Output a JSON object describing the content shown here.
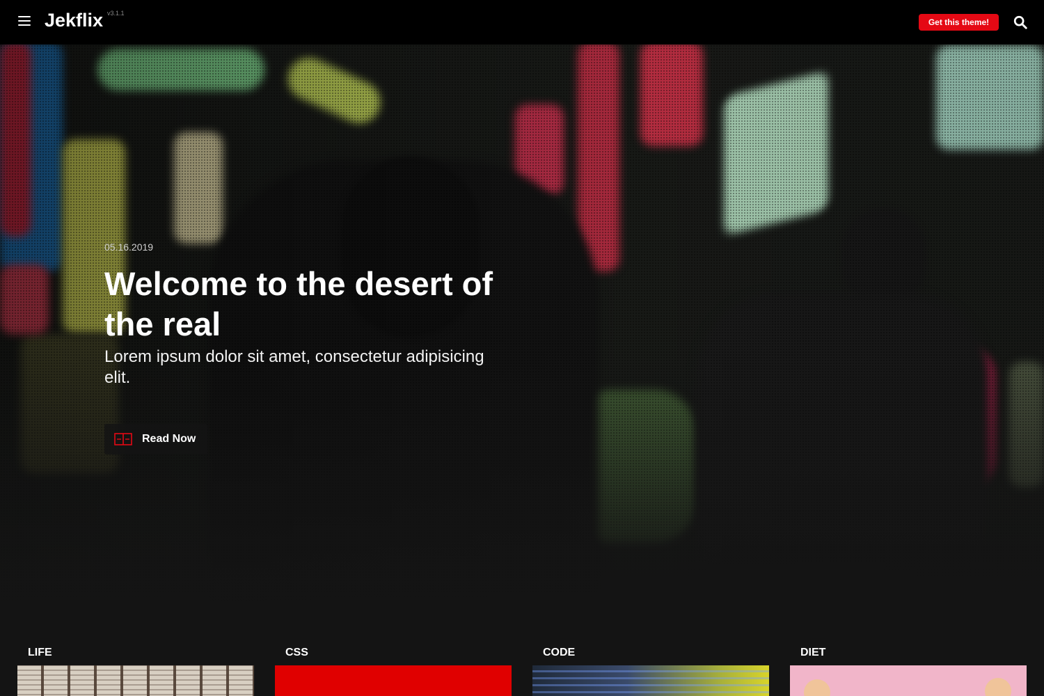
{
  "header": {
    "logo": "Jekflix",
    "version": "v3.1.1",
    "cta_label": "Get this theme!",
    "menu_icon": "hamburger-menu-icon",
    "search_icon": "search-icon"
  },
  "hero": {
    "date": "05.16.2019",
    "title": "Welcome to the desert of the real",
    "excerpt": "Lorem ipsum dolor sit amet, consectetur adipisicing elit.",
    "button_label": "Read Now",
    "button_icon": "book-icon"
  },
  "categories": [
    {
      "title": "LIFE"
    },
    {
      "title": "CSS"
    },
    {
      "title": "CODE"
    },
    {
      "title": "DIET"
    }
  ],
  "colors": {
    "accent": "#e50914",
    "background": "#141414",
    "header": "#000000"
  }
}
